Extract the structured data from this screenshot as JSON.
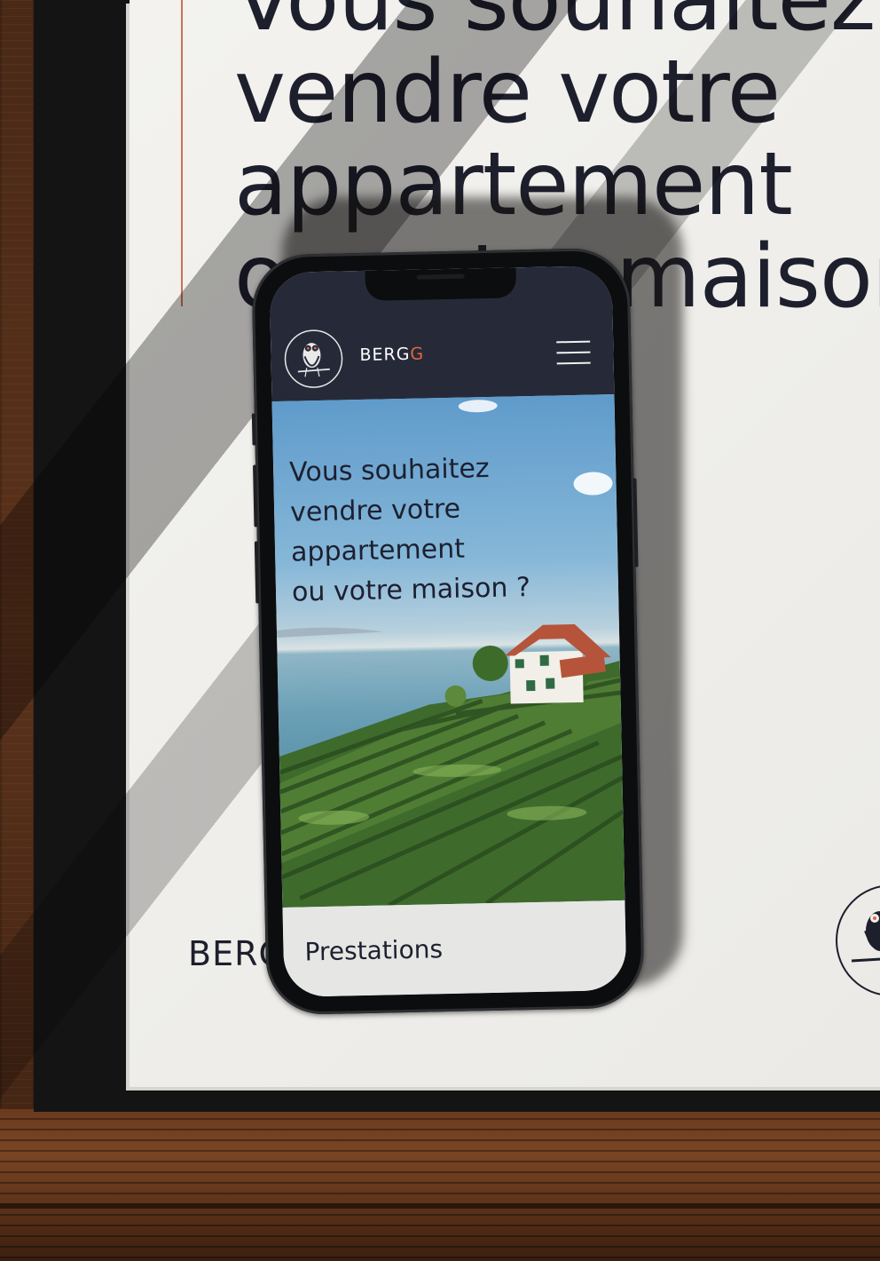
{
  "book": {
    "title_lines": [
      "Vous souhaitez",
      "vendre votre",
      "appartement",
      "ou votre maison"
    ],
    "brand": "BERGG"
  },
  "app": {
    "brand_main": "BERG",
    "brand_accent": "G",
    "hero_title_lines": [
      "Vous souhaitez",
      "vendre votre",
      "appartement",
      "ou votre maison ?"
    ],
    "nav_link": "Prestations"
  },
  "icons": {
    "logo": "owl-logo-icon",
    "menu": "hamburger-menu-icon"
  },
  "colors": {
    "header_bg": "#262a38",
    "accent": "#e7653e",
    "text_dark": "#1d2030",
    "book_rule": "#c87253"
  }
}
